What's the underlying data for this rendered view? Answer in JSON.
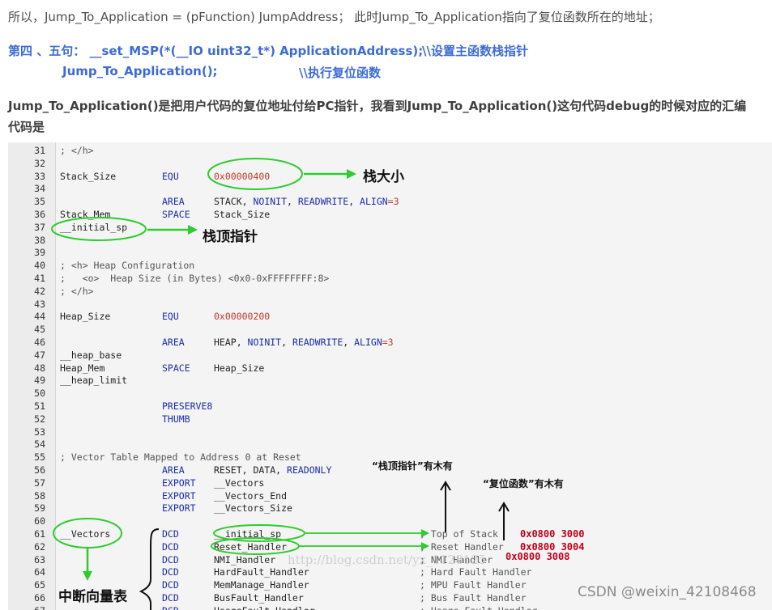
{
  "text": {
    "line1": "所以，Jump_To_Application = (pFunction) JumpAddress；  此时Jump_To_Application指向了复位函数所在的地址；",
    "line2a": "第四 、五句：  __set_MSP(*(__IO uint32_t*) ApplicationAddress);",
    "line2b": "\\\\设置主函数栈指针",
    "line3a": "Jump_To_Application();",
    "line3b": "\\\\执行复位函数",
    "line4": "Jump_To_Application()是把用户代码的复位地址付给PC指针，我看到Jump_To_Application()这句代码debug的时候对应的汇编",
    "line5": "代码是"
  },
  "code_lines": [
    {
      "num": "31",
      "label": "; </h>",
      "op": "",
      "args": ""
    },
    {
      "num": "32",
      "label": "",
      "op": "",
      "args": ""
    },
    {
      "num": "33",
      "label": "Stack_Size",
      "op": "EQU",
      "args": "0x00000400"
    },
    {
      "num": "34",
      "label": "",
      "op": "",
      "args": ""
    },
    {
      "num": "35",
      "label": "",
      "op": "AREA",
      "args": "STACK, NOINIT, READWRITE, ALIGN=3"
    },
    {
      "num": "36",
      "label": "Stack_Mem",
      "op": "SPACE",
      "args": "Stack_Size"
    },
    {
      "num": "37",
      "label": "__initial_sp",
      "op": "",
      "args": ""
    },
    {
      "num": "38",
      "label": "",
      "op": "",
      "args": ""
    },
    {
      "num": "39",
      "label": "",
      "op": "",
      "args": ""
    },
    {
      "num": "40",
      "label": "; <h> Heap Configuration",
      "op": "",
      "args": ""
    },
    {
      "num": "41",
      "label": ";   <o>  Heap Size (in Bytes) <0x0-0xFFFFFFFF:8>",
      "op": "",
      "args": ""
    },
    {
      "num": "42",
      "label": "; </h>",
      "op": "",
      "args": ""
    },
    {
      "num": "43",
      "label": "",
      "op": "",
      "args": ""
    },
    {
      "num": "44",
      "label": "Heap_Size",
      "op": "EQU",
      "args": "0x00000200"
    },
    {
      "num": "45",
      "label": "",
      "op": "",
      "args": ""
    },
    {
      "num": "46",
      "label": "",
      "op": "AREA",
      "args": "HEAP, NOINIT, READWRITE, ALIGN=3"
    },
    {
      "num": "47",
      "label": "__heap_base",
      "op": "",
      "args": ""
    },
    {
      "num": "48",
      "label": "Heap_Mem",
      "op": "SPACE",
      "args": "Heap_Size"
    },
    {
      "num": "49",
      "label": "__heap_limit",
      "op": "",
      "args": ""
    },
    {
      "num": "50",
      "label": "",
      "op": "",
      "args": ""
    },
    {
      "num": "51",
      "label": "",
      "op": "PRESERVE8",
      "args": ""
    },
    {
      "num": "52",
      "label": "",
      "op": "THUMB",
      "args": ""
    },
    {
      "num": "53",
      "label": "",
      "op": "",
      "args": ""
    },
    {
      "num": "54",
      "label": "",
      "op": "",
      "args": ""
    },
    {
      "num": "55",
      "label": "; Vector Table Mapped to Address 0 at Reset",
      "op": "",
      "args": ""
    },
    {
      "num": "56",
      "label": "",
      "op": "AREA",
      "args": "RESET, DATA, READONLY"
    },
    {
      "num": "57",
      "label": "",
      "op": "EXPORT",
      "args": "__Vectors"
    },
    {
      "num": "58",
      "label": "",
      "op": "EXPORT",
      "args": "__Vectors_End"
    },
    {
      "num": "59",
      "label": "",
      "op": "EXPORT",
      "args": "__Vectors_Size"
    },
    {
      "num": "60",
      "label": "",
      "op": "",
      "args": ""
    },
    {
      "num": "61",
      "label": "__Vectors",
      "op": "DCD",
      "args": "__initial_sp",
      "comment": "; Top of Stack"
    },
    {
      "num": "62",
      "label": "",
      "op": "DCD",
      "args": "Reset_Handler",
      "comment": "; Reset Handler"
    },
    {
      "num": "63",
      "label": "",
      "op": "DCD",
      "args": "NMI_Handler",
      "comment": "; NMI Handler"
    },
    {
      "num": "64",
      "label": "",
      "op": "DCD",
      "args": "HardFault_Handler",
      "comment": "; Hard Fault Handler"
    },
    {
      "num": "65",
      "label": "",
      "op": "DCD",
      "args": "MemManage_Handler",
      "comment": "; MPU Fault Handler"
    },
    {
      "num": "66",
      "label": "",
      "op": "DCD",
      "args": "BusFault_Handler",
      "comment": "; Bus Fault Handler"
    },
    {
      "num": "67",
      "label": "",
      "op": "DCD",
      "args": "UsageFault_Handler",
      "comment": "; Usage Fault Handler"
    }
  ],
  "annotations": {
    "stack_size": "栈大小",
    "stack_top": "栈顶指针",
    "vector_table": "中断向量表",
    "has_stack_ptr": "“栈顶指针”有木有",
    "has_reset": "“复位函数”有木有",
    "addr1": "0x0800  3000",
    "addr2": "0x0800  3004",
    "addr3": "0x0800  3008"
  },
  "watermark": "http://blog.csdn.net/yx_1128125",
  "csdn": "CSDN @weixin_42108468"
}
